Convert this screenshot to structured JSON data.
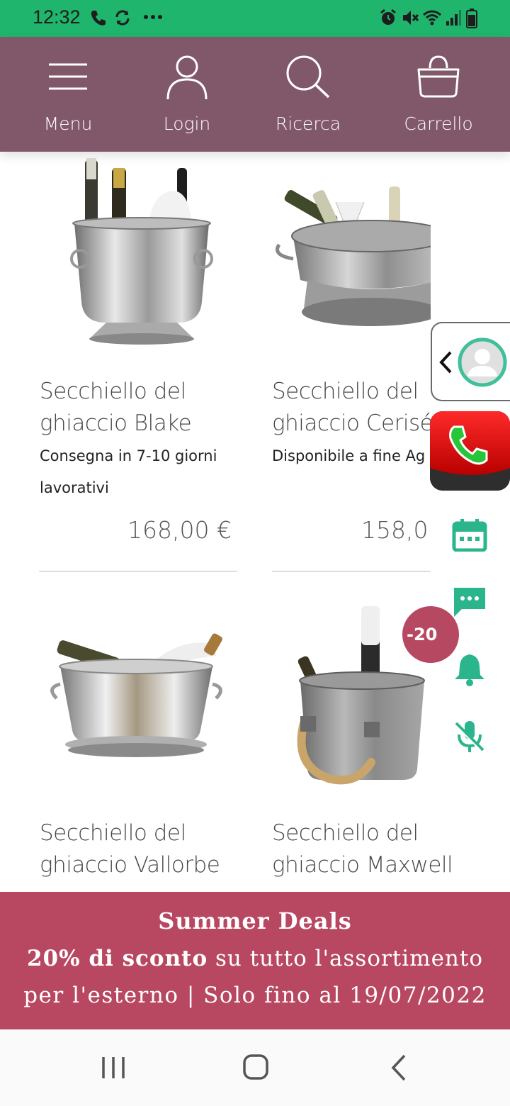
{
  "status_bar": {
    "time": "12:32"
  },
  "nav": {
    "menu_label": "Menu",
    "login_label": "Login",
    "search_label": "Ricerca",
    "cart_label": "Carrello"
  },
  "products": [
    {
      "title_line1": "Secchiello del",
      "title_line2": "ghiaccio Blake",
      "avail_line1": "Consegna in 7-10 giorni",
      "avail_line2": "lavorativi",
      "price": "168,00 €"
    },
    {
      "title_line1": "Secchiello del",
      "title_line2": "ghiaccio Cerisé",
      "avail_line1": "Disponibile a fine Ag",
      "price": "158,0"
    },
    {
      "title_line1": "Secchiello del",
      "title_line2": "ghiaccio Vallorbe"
    },
    {
      "title_line1": "Secchiello del",
      "title_line2": "ghiaccio Maxwell",
      "badge": "-20"
    }
  ],
  "promo": {
    "title": "Summer Deals",
    "line2_bold": "20% di sconto",
    "line2_rest": " su tutto l'assortimento",
    "line3": "per l'esterno | Solo fino al 19/07/2022"
  },
  "colors": {
    "status_bar": "#1fb56d",
    "header": "#81586a",
    "promo": "#b84862",
    "widget_teal": "#2bb58c"
  }
}
